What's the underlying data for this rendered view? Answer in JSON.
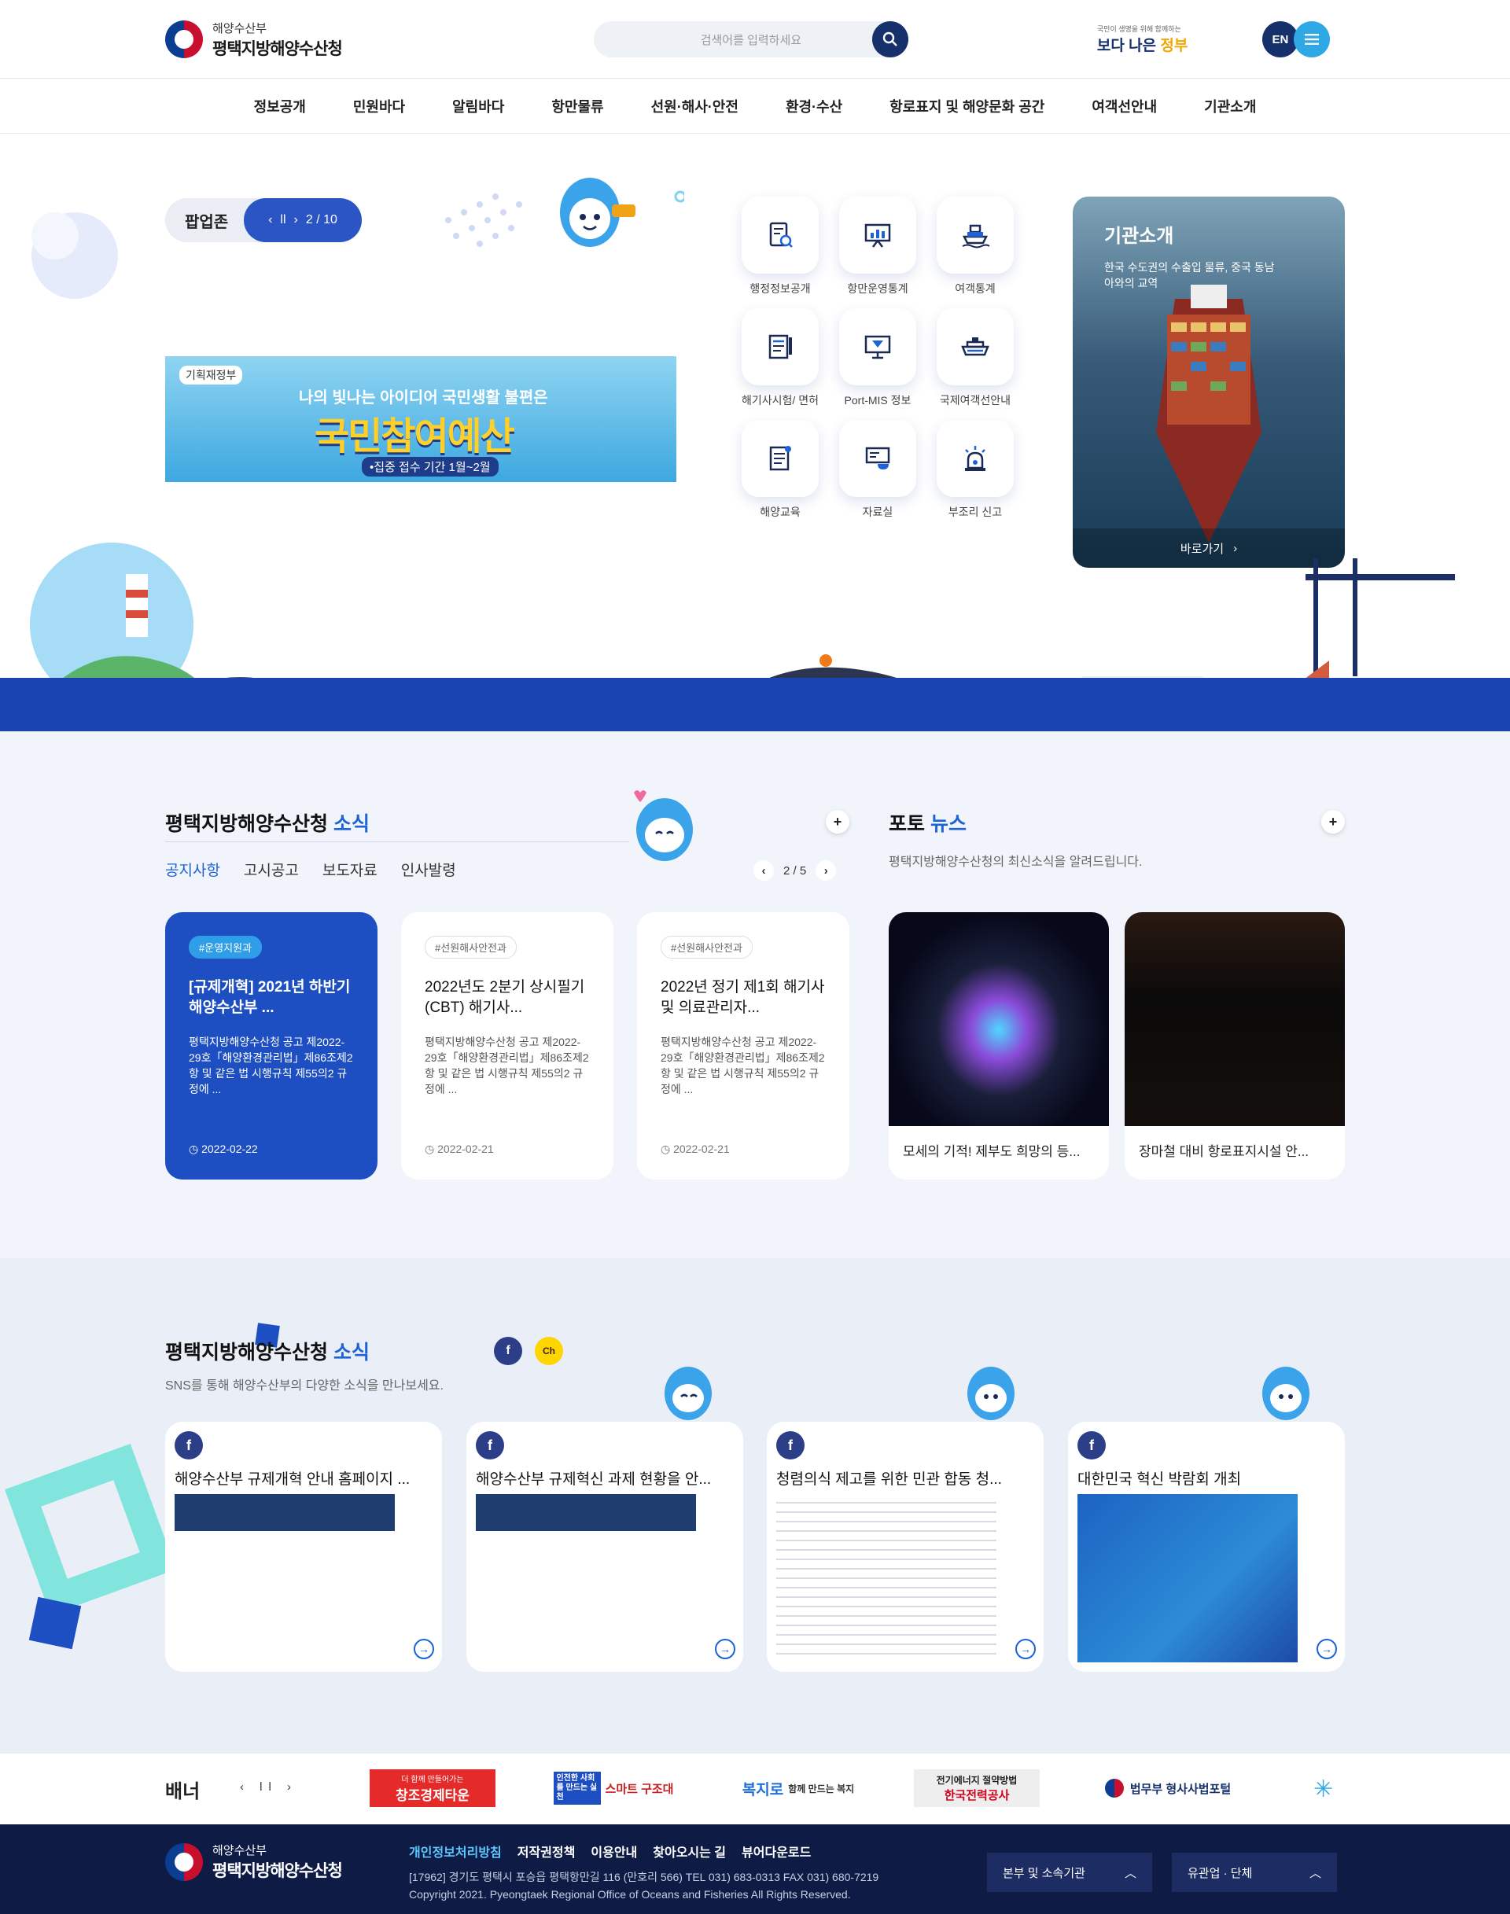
{
  "header": {
    "logo_sub": "해양수산부",
    "logo_main": "평택지방해양수산청",
    "search_placeholder": "검색어를 입력하세요",
    "gov_badge_small": "국민이 생명을 위해 함께하는",
    "gov_badge_main": "보다 나은 ",
    "gov_badge_accent": "정부",
    "lang_label": "EN"
  },
  "gnb": [
    "정보공개",
    "민원바다",
    "알림바다",
    "항만물류",
    "선원·해사·안전",
    "환경·수산",
    "항로표지 및 해양문화 공간",
    "여객선안내",
    "기관소개"
  ],
  "popup": {
    "label": "팝업존",
    "counter": "2 / 10",
    "banner_org": "기획재정부",
    "banner_line1": "나의 빛나는 아이디어 국민생활 불편은",
    "banner_line2": "국민참여예산",
    "banner_line3": "•집중 접수 기간 1월~2월"
  },
  "quick_links": [
    {
      "label": "행정정보공개",
      "icon": "document-search-icon"
    },
    {
      "label": "항만운영통계",
      "icon": "presentation-chart-icon"
    },
    {
      "label": "여객통계",
      "icon": "ship-icon"
    },
    {
      "label": "해기사시험/ 면허",
      "icon": "exam-icon"
    },
    {
      "label": "Port-MIS 정보",
      "icon": "monitor-icon"
    },
    {
      "label": "국제여객선안내",
      "icon": "cruise-ship-icon"
    },
    {
      "label": "해양교육",
      "icon": "notepad-icon"
    },
    {
      "label": "자료실",
      "icon": "archive-icon"
    },
    {
      "label": "부조리 신고",
      "icon": "alarm-icon"
    }
  ],
  "intro": {
    "title": "기관소개",
    "desc": "한국 수도권의 수출입 물류, 중국 동남아와의 교역",
    "go": "바로가기"
  },
  "news": {
    "title": "평택지방해양수산청",
    "title_accent": " 소식",
    "tabs": [
      "공지사항",
      "고시공고",
      "보도자료",
      "인사발령"
    ],
    "counter": "2 / 5",
    "cards": [
      {
        "tag": "#운영지원과",
        "title": "[규제개혁] 2021년 하반기 해양수산부 ...",
        "body": "평택지방해양수산청 공고 제2022-29호「해양환경관리법」제86조제2항 및 같은 법 시행규칙 제55의2 규정에 ...",
        "date": "2022-02-22"
      },
      {
        "tag": "#선원해사안전과",
        "title": "2022년도 2분기 상시필기(CBT) 해기사...",
        "body": "평택지방해양수산청 공고 제2022-29호「해양환경관리법」제86조제2항 및 같은 법 시행규칙 제55의2 규정에 ...",
        "date": "2022-02-21"
      },
      {
        "tag": "#선원해사안전과",
        "title": "2022년 정기 제1회 해기사 및 의료관리자...",
        "body": "평택지방해양수산청 공고 제2022-29호「해양환경관리법」제86조제2항 및 같은 법 시행규칙 제55의2 규정에 ...",
        "date": "2022-02-21"
      }
    ]
  },
  "photo": {
    "title": "포토",
    "title_accent": " 뉴스",
    "desc": "평택지방해양수산청의 최신소식을 알려드립니다.",
    "items": [
      {
        "caption": "모세의 기적! 제부도 희망의 등..."
      },
      {
        "caption": "장마철 대비 항로표지시설 안..."
      }
    ]
  },
  "sns": {
    "title": "평택지방해양수산청",
    "title_accent": " 소식",
    "desc": "SNS를 통해 해양수산부의 다양한 소식을 만나보세요.",
    "items": [
      {
        "title": "해양수산부 규제개혁 안내 홈페이지 ..."
      },
      {
        "title": "해양수산부 규제혁신 과제 현황을 안..."
      },
      {
        "title": "청렴의식 제고를 위한 민관 합동 청..."
      },
      {
        "title": "대한민국 혁신 박람회 개최"
      }
    ]
  },
  "banners": {
    "label": "배너",
    "items": [
      "창조경제타운",
      "스마트 구조대",
      "함께 만드는 복지",
      "한국전력공사",
      "법무부 형사사법포털"
    ],
    "sub": [
      "더 함께 만들어가는",
      "인전한 사회를 만드는 실천",
      "복지로",
      "전기에너지 절약방법",
      ""
    ]
  },
  "footer": {
    "logo_sub": "해양수산부",
    "logo_main": "평택지방해양수산청",
    "links": [
      "개인정보처리방침",
      "저작권정책",
      "이용안내",
      "찾아오시는 길",
      "뷰어다운로드"
    ],
    "address": "[17962] 경기도 평택시 포승읍 평택항만길 116 (만호리 566) TEL 031) 683-0313 FAX 031) 680-7219",
    "copyright": "Copyright 2021. Pyeongtaek Regional Office of Oceans and Fisheries All Rights Reserved.",
    "select1": "본부 및 소속기관",
    "select2": "유관업 · 단체"
  },
  "colors": {
    "primary": "#15306b",
    "accent": "#1b63d6",
    "sea": "#1a45b0",
    "footer": "#0d1b45"
  }
}
